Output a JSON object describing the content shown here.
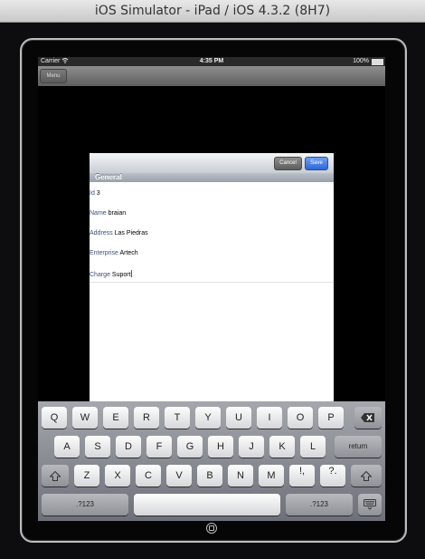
{
  "window": {
    "title": "iOS Simulator - iPad / iOS 4.3.2 (8H7)"
  },
  "status_bar": {
    "carrier": "Carrier",
    "time": "4:35 PM",
    "battery": "100%"
  },
  "nav": {
    "menu_label": "Menu"
  },
  "form": {
    "cancel_label": "Cancel",
    "save_label": "Save",
    "section": "General",
    "fields": [
      {
        "label": "Id",
        "value": "3"
      },
      {
        "label": "Name",
        "value": "braian"
      },
      {
        "label": "Address",
        "value": "Las Piedras"
      },
      {
        "label": "Enterprise",
        "value": "Artech"
      },
      {
        "label": "Charge",
        "value": "Suport"
      }
    ]
  },
  "keyboard": {
    "row1": [
      "Q",
      "W",
      "E",
      "R",
      "T",
      "Y",
      "U",
      "I",
      "O",
      "P"
    ],
    "row2": [
      "A",
      "S",
      "D",
      "F",
      "G",
      "H",
      "J",
      "K",
      "L"
    ],
    "row3": [
      "Z",
      "X",
      "C",
      "V",
      "B",
      "N",
      "M",
      "!,",
      "?."
    ],
    "return_label": "return",
    "numbers_label": ".?123",
    "icons": {
      "delete": "backspace-icon",
      "shift": "shift-icon",
      "hide": "keyboard-hide-icon"
    }
  }
}
